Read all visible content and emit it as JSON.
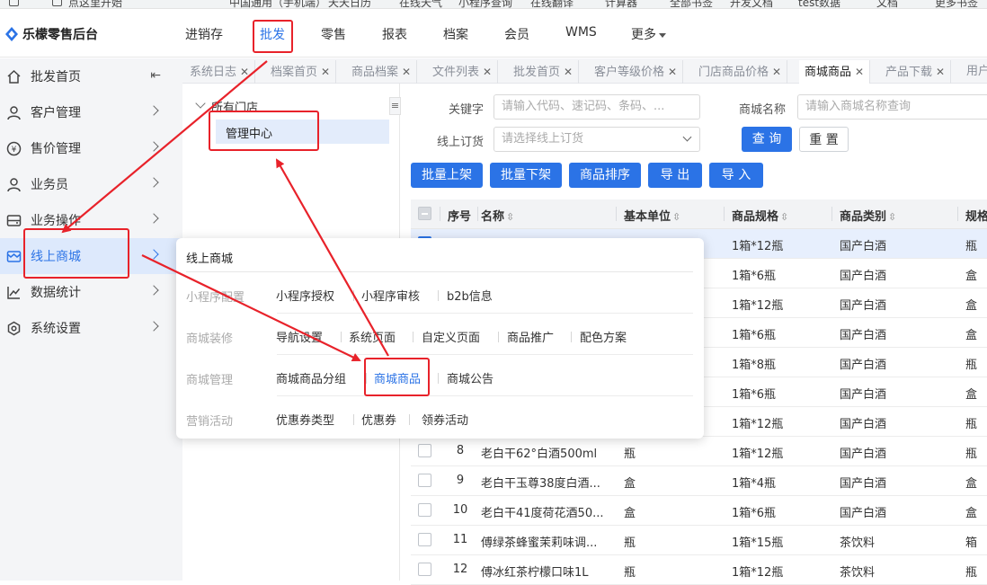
{
  "browser_bookmarks": [
    "点这里开始",
    "中国通用（手机端）",
    "天天日历",
    "在线天气",
    "小程序查询",
    "在线翻译",
    "计算器",
    "全部书签",
    "开发文档",
    "test数据",
    "文档",
    "更多书签"
  ],
  "header": {
    "logo": "乐檬零售后台",
    "nav": [
      "进销存",
      "批发",
      "零售",
      "报表",
      "档案",
      "会员",
      "WMS",
      "更多"
    ],
    "active_nav": "批发",
    "accent": "#2b73e6"
  },
  "sidebar": {
    "items": [
      {
        "label": "批发首页",
        "icon": "home-icon"
      },
      {
        "label": "客户管理",
        "icon": "user-icon"
      },
      {
        "label": "售价管理",
        "icon": "price-icon"
      },
      {
        "label": "业务员",
        "icon": "person-icon"
      },
      {
        "label": "业务操作",
        "icon": "operation-icon"
      },
      {
        "label": "线上商城",
        "icon": "store-icon"
      },
      {
        "label": "数据统计",
        "icon": "chart-icon"
      },
      {
        "label": "系统设置",
        "icon": "settings-icon"
      }
    ],
    "active": "线上商城"
  },
  "tabs": [
    {
      "label": "系统日志"
    },
    {
      "label": "档案首页"
    },
    {
      "label": "商品档案"
    },
    {
      "label": "文件列表"
    },
    {
      "label": "批发首页"
    },
    {
      "label": "客户等级价格"
    },
    {
      "label": "门店商品价格"
    },
    {
      "label": "商城商品",
      "active": true
    },
    {
      "label": "产品下载"
    },
    {
      "label": "用户"
    }
  ],
  "tree": {
    "root": "所有门店",
    "child": "管理中心"
  },
  "filters": {
    "keyword_label": "关键字",
    "keyword_placeholder": "请输入代码、速记码、条码、...",
    "mall_name_label": "商城名称",
    "mall_name_placeholder": "请输入商城名称查询",
    "order_label": "线上订货",
    "order_placeholder": "请选择线上订货",
    "search": "查 询",
    "reset": "重 置"
  },
  "actions": [
    "批量上架",
    "批量下架",
    "商品排序",
    "导 出",
    "导 入"
  ],
  "table": {
    "columns": [
      "序号",
      "名称",
      "基本单位",
      "商品规格",
      "商品类别",
      "规格"
    ],
    "rows": [
      {
        "no": "",
        "name": "",
        "unit": "",
        "spec": "1箱*12瓶",
        "category": "国产白酒",
        "pack": "瓶",
        "selected": true
      },
      {
        "no": "",
        "name": "",
        "unit": "",
        "spec": "1箱*6瓶",
        "category": "国产白酒",
        "pack": "盒"
      },
      {
        "no": "",
        "name": "",
        "unit": "",
        "spec": "1箱*12瓶",
        "category": "国产白酒",
        "pack": "盒"
      },
      {
        "no": "",
        "name": "",
        "unit": "",
        "spec": "1箱*6瓶",
        "category": "国产白酒",
        "pack": "盒"
      },
      {
        "no": "",
        "name": "",
        "unit": "",
        "spec": "1箱*8瓶",
        "category": "国产白酒",
        "pack": "瓶"
      },
      {
        "no": "",
        "name": "",
        "unit": "",
        "spec": "1箱*6瓶",
        "category": "国产白酒",
        "pack": "盒"
      },
      {
        "no": "",
        "name": "",
        "unit": "",
        "spec": "1箱*12瓶",
        "category": "国产白酒",
        "pack": "瓶"
      },
      {
        "no": "8",
        "name": "老白干62°白酒500ml",
        "unit": "瓶",
        "spec": "1箱*12瓶",
        "category": "国产白酒",
        "pack": "瓶"
      },
      {
        "no": "9",
        "name": "老白干玉尊38度白酒...",
        "unit": "盒",
        "spec": "1箱*4瓶",
        "category": "国产白酒",
        "pack": "盒"
      },
      {
        "no": "10",
        "name": "老白干41度荷花酒50...",
        "unit": "盒",
        "spec": "1箱*6瓶",
        "category": "国产白酒",
        "pack": "盒"
      },
      {
        "no": "11",
        "name": "傅绿茶蜂蜜茉莉味调...",
        "unit": "瓶",
        "spec": "1箱*15瓶",
        "category": "茶饮料",
        "pack": "箱"
      },
      {
        "no": "12",
        "name": "傅冰红茶柠檬口味1L",
        "unit": "瓶",
        "spec": "1箱*12瓶",
        "category": "茶饮料",
        "pack": "瓶"
      }
    ]
  },
  "popup": {
    "title": "线上商城",
    "groups": [
      {
        "title": "小程序配置",
        "links": [
          "小程序授权",
          "小程序审核",
          "b2b信息"
        ]
      },
      {
        "title": "商城装修",
        "links": [
          "导航设置",
          "系统页面",
          "自定义页面",
          "商品推广",
          "配色方案"
        ]
      },
      {
        "title": "商城管理",
        "links": [
          "商城商品分组",
          "商城商品",
          "商城公告"
        ],
        "highlight": "商城商品"
      },
      {
        "title": "营销活动",
        "links": [
          "优惠券类型",
          "优惠券",
          "领券活动"
        ]
      }
    ]
  },
  "annotation_color": "#e8222a"
}
